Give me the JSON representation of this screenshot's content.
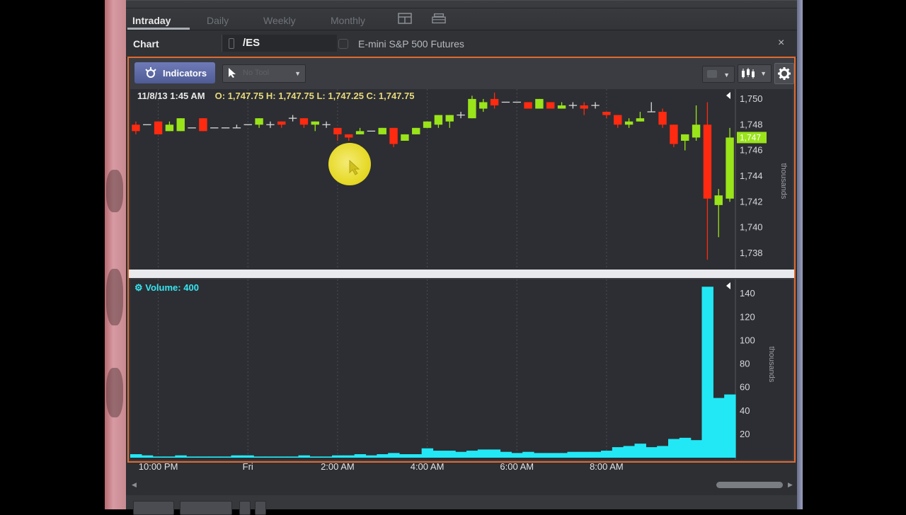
{
  "tabs": [
    {
      "label": "Intraday",
      "active": true
    },
    {
      "label": "Daily",
      "active": false
    },
    {
      "label": "Weekly",
      "active": false
    },
    {
      "label": "Monthly",
      "active": false
    }
  ],
  "header": {
    "title": "Chart",
    "symbol": "/ES",
    "description": "E-mini S&P 500 Futures",
    "close_label": "×"
  },
  "toolbar": {
    "indicators_label": "Indicators",
    "tool_placeholder": "No Tool"
  },
  "price_pane": {
    "date_time": "11/8/13 1:45 AM",
    "ohlc": "O: 1,747.75  H: 1,747.75  L: 1,747.25  C: 1,747.75",
    "last_price_tag": "1,747",
    "axis_unit": "thousands"
  },
  "volume_pane": {
    "label": "Volume:",
    "value": "400",
    "axis_unit": "thousands"
  },
  "colors": {
    "up": "#9ae41a",
    "down": "#ff2a10",
    "doji": "#d8d8d8",
    "volume": "#22e8f5",
    "frame": "#e06a30",
    "indicators_button": "#5e6aa8",
    "cursor_highlight": "#f0e22a"
  },
  "chart_data": [
    {
      "type": "candlestick",
      "y_tick_labels": [
        "1,750",
        "1,748",
        "1,746",
        "1,744",
        "1,742",
        "1,740",
        "1,738"
      ],
      "y_ticks": [
        1750,
        1748,
        1746,
        1744,
        1742,
        1740,
        1738
      ],
      "ylim": [
        1736.9,
        1750.6
      ],
      "x_tick_labels": [
        "10:00 PM",
        "Fri",
        "2:00 AM",
        "4:00 AM",
        "6:00 AM",
        "8:00 AM"
      ],
      "x_tick_index": [
        2,
        10,
        18,
        26,
        34,
        42
      ],
      "last_price": 1747.0,
      "candles": [
        [
          1748.0,
          1747.5,
          1748.25,
          1747.25
        ],
        [
          1748.0,
          1748.0,
          1748.0,
          1748.0
        ],
        [
          1748.25,
          1747.25,
          1748.25,
          1747.25
        ],
        [
          1747.5,
          1748.0,
          1748.25,
          1747.5
        ],
        [
          1747.5,
          1748.5,
          1748.5,
          1747.5
        ],
        [
          1747.75,
          1747.75,
          1747.75,
          1747.75
        ],
        [
          1748.5,
          1747.5,
          1748.5,
          1747.5
        ],
        [
          1747.75,
          1747.75,
          1747.75,
          1747.75
        ],
        [
          1747.75,
          1747.75,
          1747.75,
          1747.75
        ],
        [
          1747.75,
          1747.75,
          1748.0,
          1747.75
        ],
        [
          1748.0,
          1748.0,
          1748.0,
          1748.0
        ],
        [
          1748.0,
          1748.5,
          1748.5,
          1747.75
        ],
        [
          1748.0,
          1748.0,
          1748.25,
          1747.75
        ],
        [
          1748.25,
          1748.0,
          1748.25,
          1747.75
        ],
        [
          1748.5,
          1748.5,
          1748.75,
          1748.25
        ],
        [
          1748.5,
          1748.0,
          1748.5,
          1747.75
        ],
        [
          1748.0,
          1748.25,
          1748.25,
          1747.5
        ],
        [
          1748.0,
          1748.0,
          1748.25,
          1747.75
        ],
        [
          1747.75,
          1747.25,
          1747.75,
          1746.75
        ],
        [
          1747.25,
          1747.0,
          1747.25,
          1746.75
        ],
        [
          1747.25,
          1747.5,
          1747.75,
          1747.25
        ],
        [
          1747.5,
          1747.5,
          1747.5,
          1747.5
        ],
        [
          1747.25,
          1747.75,
          1747.75,
          1747.25
        ],
        [
          1747.75,
          1746.5,
          1747.75,
          1746.25
        ],
        [
          1746.75,
          1747.25,
          1747.25,
          1746.75
        ],
        [
          1747.25,
          1747.75,
          1747.75,
          1747.25
        ],
        [
          1747.75,
          1748.25,
          1748.25,
          1747.75
        ],
        [
          1748.0,
          1748.75,
          1748.75,
          1747.75
        ],
        [
          1748.25,
          1748.75,
          1748.75,
          1747.75
        ],
        [
          1748.75,
          1748.75,
          1749.0,
          1748.5
        ],
        [
          1748.5,
          1750.0,
          1750.25,
          1748.5
        ],
        [
          1749.25,
          1749.75,
          1750.0,
          1749.0
        ],
        [
          1750.0,
          1749.5,
          1750.5,
          1749.25
        ],
        [
          1749.75,
          1749.75,
          1749.75,
          1749.75
        ],
        [
          1749.75,
          1749.75,
          1749.75,
          1749.75
        ],
        [
          1749.75,
          1749.25,
          1749.75,
          1749.25
        ],
        [
          1749.25,
          1750.0,
          1750.0,
          1749.25
        ],
        [
          1749.75,
          1749.25,
          1749.75,
          1749.25
        ],
        [
          1749.25,
          1749.5,
          1749.75,
          1749.25
        ],
        [
          1749.5,
          1749.5,
          1749.75,
          1749.25
        ],
        [
          1749.5,
          1749.25,
          1749.75,
          1748.75
        ],
        [
          1749.5,
          1749.5,
          1749.75,
          1749.25
        ],
        [
          1749.0,
          1748.75,
          1749.0,
          1748.5
        ],
        [
          1748.75,
          1748.0,
          1748.75,
          1747.75
        ],
        [
          1748.0,
          1748.25,
          1748.5,
          1747.75
        ],
        [
          1748.25,
          1748.5,
          1749.0,
          1748.25
        ],
        [
          1749.0,
          1749.0,
          1749.75,
          1749.0
        ],
        [
          1749.0,
          1748.0,
          1749.25,
          1747.75
        ],
        [
          1748.0,
          1746.5,
          1748.0,
          1746.25
        ],
        [
          1746.75,
          1747.25,
          1747.25,
          1746.0
        ],
        [
          1747.0,
          1748.0,
          1749.5,
          1746.75
        ],
        [
          1748.0,
          1742.25,
          1749.75,
          1737.5
        ],
        [
          1741.75,
          1742.5,
          1743.0,
          1739.25
        ],
        [
          1742.25,
          1747.0,
          1747.75,
          1742.0
        ]
      ]
    },
    {
      "type": "bar",
      "series": [
        {
          "name": "Volume",
          "values": [
            3,
            2,
            1,
            1,
            2,
            1,
            1,
            1,
            1,
            2,
            2,
            1,
            1,
            1,
            1,
            2,
            1,
            1,
            2,
            2,
            3,
            2,
            3,
            4,
            3,
            3,
            8,
            6,
            6,
            5,
            6,
            7,
            7,
            5,
            4,
            5,
            4,
            4,
            4,
            5,
            5,
            5,
            6,
            9,
            10,
            12,
            9,
            10,
            16,
            17,
            15,
            146,
            51,
            54
          ]
        }
      ],
      "y_tick_labels": [
        "140",
        "120",
        "100",
        "80",
        "60",
        "40",
        "20"
      ],
      "y_ticks": [
        140,
        120,
        100,
        80,
        60,
        40,
        20
      ],
      "ylim": [
        0,
        148
      ],
      "unit": "thousands"
    }
  ]
}
